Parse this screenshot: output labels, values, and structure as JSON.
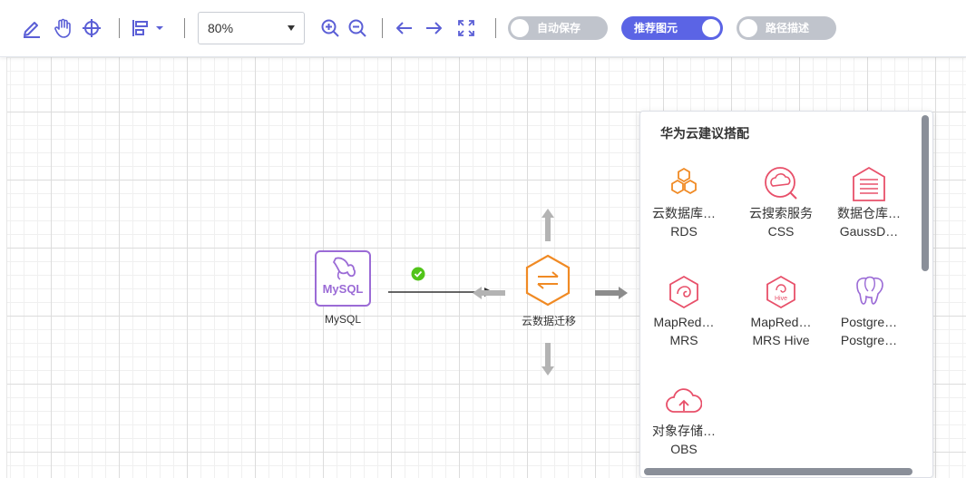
{
  "toolbar": {
    "icons": [
      "pen-icon",
      "hand-icon",
      "crosshair-icon",
      "align-icon",
      "dropdown-caret-icon",
      "zoom-in-icon",
      "zoom-out-icon",
      "undo-icon",
      "redo-icon",
      "fit-screen-icon"
    ],
    "zoom_value": "80%",
    "toggles": {
      "auto_save": {
        "label": "自动保存",
        "on": false
      },
      "recommend": {
        "label": "推荐图元",
        "on": true
      },
      "path_desc": {
        "label": "路径描述",
        "on": false
      }
    }
  },
  "canvas": {
    "nodes": {
      "mysql": {
        "icon_text": "MySQL",
        "label": "MySQL"
      },
      "migration": {
        "label": "云数据迁移"
      }
    },
    "colors": {
      "mysql": "#9b6bd6",
      "migration": "#f08a24",
      "check": "#52c41a",
      "arrow": "#b3b3b3"
    }
  },
  "panel": {
    "title": "华为云建议搭配",
    "items": [
      {
        "line1": "云数据库…",
        "line2": "RDS",
        "icon": "rds-icon"
      },
      {
        "line1": "云搜索服务",
        "line2": "CSS",
        "icon": "css-icon"
      },
      {
        "line1": "数据仓库…",
        "line2": "GaussD…",
        "icon": "gaussdb-icon"
      },
      {
        "line1": "MapRed…",
        "line2": "MRS",
        "icon": "mrs-icon"
      },
      {
        "line1": "MapRed…",
        "line2": "MRS Hive",
        "icon": "mrs-hive-icon"
      },
      {
        "line1": "Postgre…",
        "line2": "Postgre…",
        "icon": "postgres-icon"
      },
      {
        "line1": "对象存储…",
        "line2": "OBS",
        "icon": "obs-icon"
      }
    ],
    "hive_badge": "Hive"
  }
}
